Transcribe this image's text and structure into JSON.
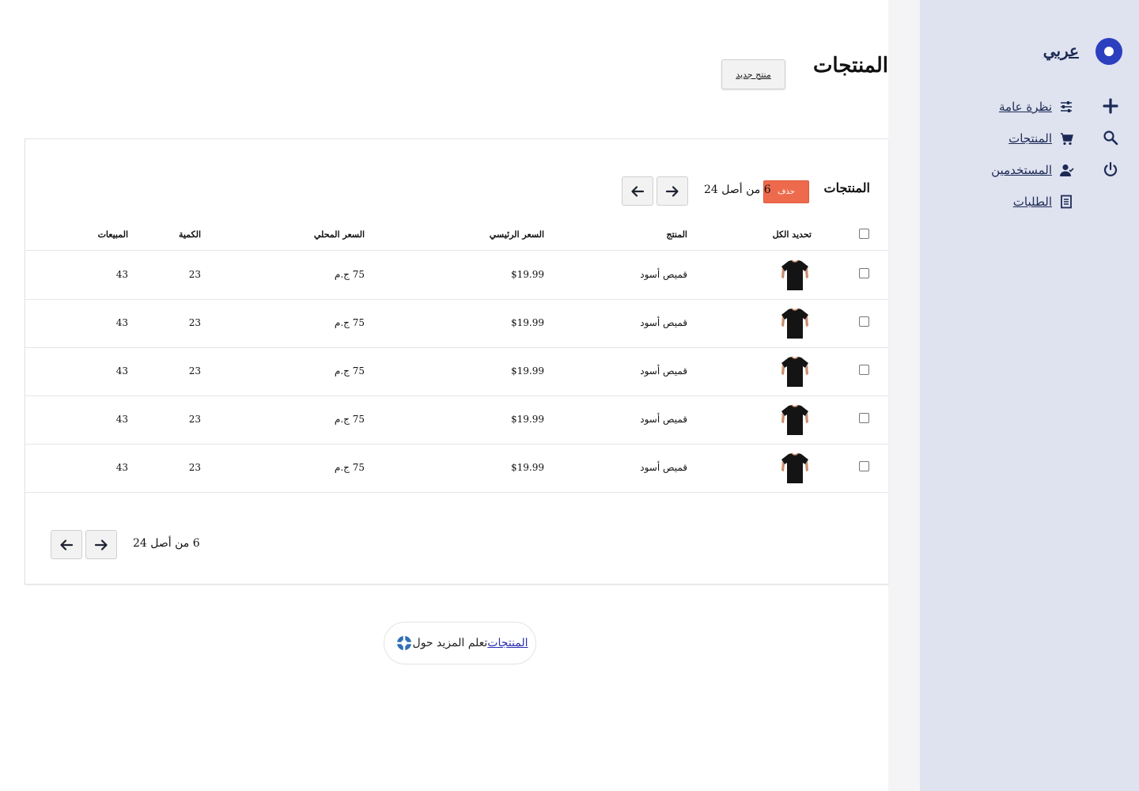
{
  "sidebar": {
    "brand": "عربي",
    "items": [
      {
        "label": "نظرة عامة",
        "icon": "sliders-icon"
      },
      {
        "label": "المنتجات",
        "icon": "cart-icon"
      },
      {
        "label": "المستخدمين",
        "icon": "user-icon"
      },
      {
        "label": "الطلبات",
        "icon": "document-icon"
      }
    ],
    "side_icons": [
      "plus-icon",
      "search-icon",
      "power-icon"
    ],
    "colors": {
      "background": "#dfe2ef",
      "accent": "#2b3fbf"
    }
  },
  "header": {
    "title": "المنتجات",
    "new_button": "منتج جديد"
  },
  "card": {
    "title": "المنتجات",
    "delete_button": "حذف",
    "pager_text": "6 من أصل 24",
    "columns": {
      "select_all": "تحديد الكل",
      "product": "المنتج",
      "base_price": "السعر الرئيسي",
      "local_price": "السعر المحلي",
      "quantity": "الكمية",
      "sales": "المبيعات"
    },
    "rows": [
      {
        "name": "قميص أسود",
        "base_price": "$19.99",
        "local_price": "75 ج.م",
        "quantity": "23",
        "sales": "43"
      },
      {
        "name": "قميص أسود",
        "base_price": "$19.99",
        "local_price": "75 ج.م",
        "quantity": "23",
        "sales": "43"
      },
      {
        "name": "قميص أسود",
        "base_price": "$19.99",
        "local_price": "75 ج.م",
        "quantity": "23",
        "sales": "43"
      },
      {
        "name": "قميص أسود",
        "base_price": "$19.99",
        "local_price": "75 ج.م",
        "quantity": "23",
        "sales": "43"
      },
      {
        "name": "قميص أسود",
        "base_price": "$19.99",
        "local_price": "75 ج.م",
        "quantity": "23",
        "sales": "43"
      }
    ],
    "footer_pager_text": "6 من أصل 24",
    "colors": {
      "delete": "#ee6a4c"
    }
  },
  "help": {
    "text": "تعلم المزيد حول",
    "link": "المنتجات"
  }
}
